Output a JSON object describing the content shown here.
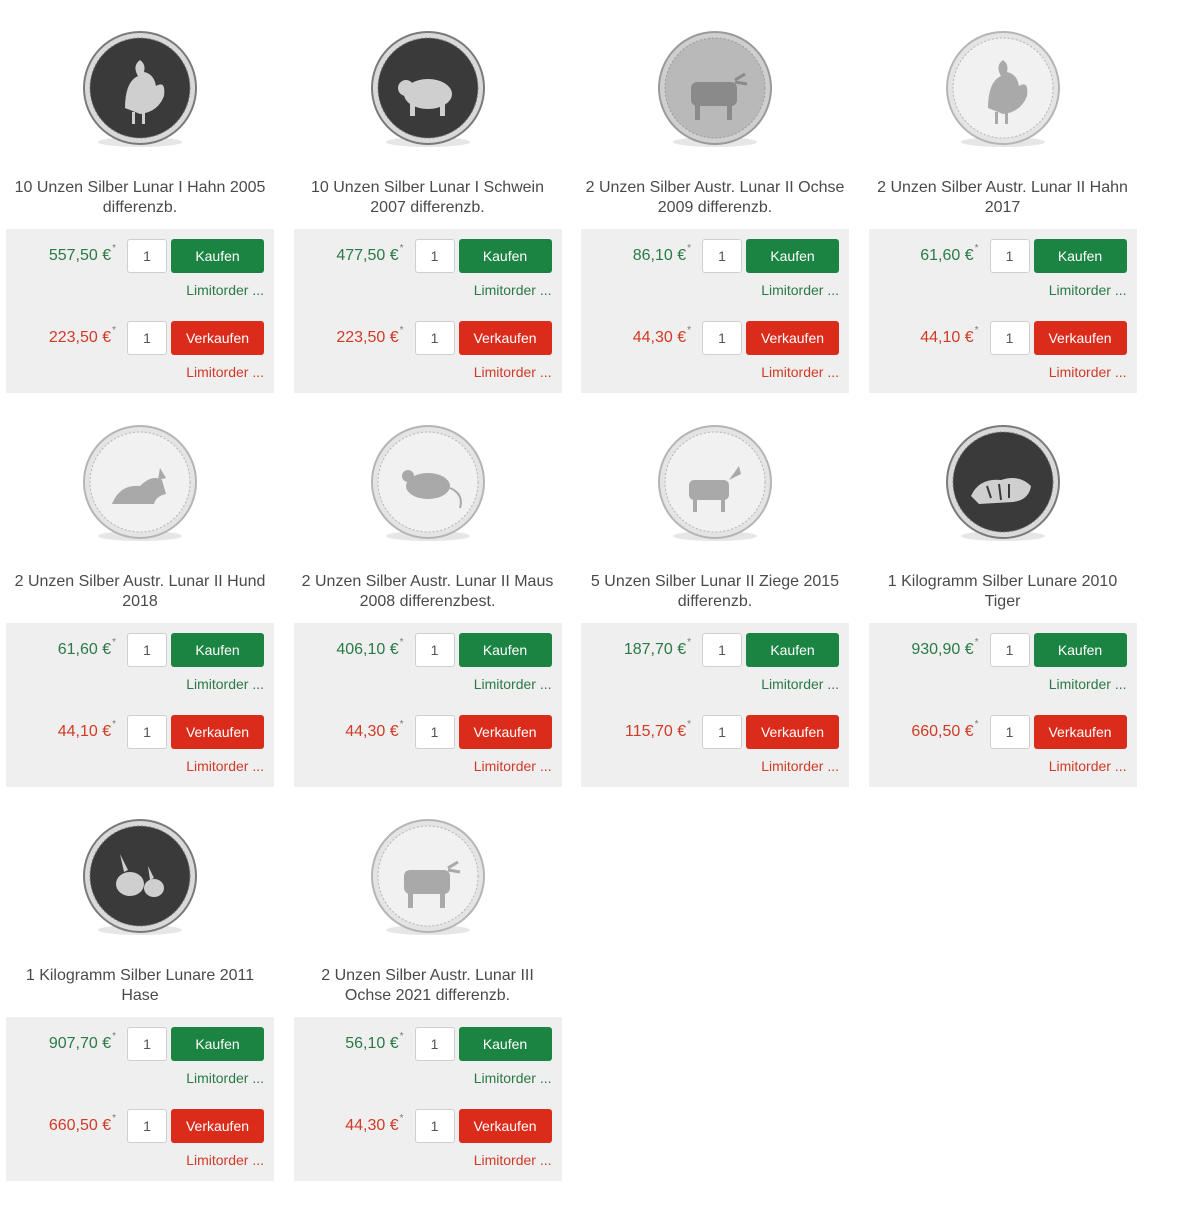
{
  "labels": {
    "buy_button": "Kaufen",
    "sell_button": "Verkaufen",
    "limit_order": "Limitorder ...",
    "price_marker": "*",
    "default_quantity": "1"
  },
  "colors": {
    "buy_green": "#1b8442",
    "sell_red": "#da2b1b",
    "panel_bg": "#efefef"
  },
  "products": [
    {
      "title": "10 Unzen Silber Lunar I Hahn 2005 differenzb.",
      "buy_price": "557,50 €",
      "sell_price": "223,50 €",
      "coin": {
        "icon": "rooster-coin-icon",
        "finish": "dark"
      }
    },
    {
      "title": "10 Unzen Silber Lunar I Schwein 2007 differenzb.",
      "buy_price": "477,50 €",
      "sell_price": "223,50 €",
      "coin": {
        "icon": "pig-coin-icon",
        "finish": "dark"
      }
    },
    {
      "title": "2 Unzen Silber Austr. Lunar II Ochse 2009 differenzb.",
      "buy_price": "86,10 €",
      "sell_price": "44,30 €",
      "coin": {
        "icon": "ox-coin-icon",
        "finish": "matte"
      }
    },
    {
      "title": "2 Unzen Silber Austr. Lunar II Hahn 2017",
      "buy_price": "61,60 €",
      "sell_price": "44,10 €",
      "coin": {
        "icon": "rooster-coin-icon",
        "finish": "bright"
      }
    },
    {
      "title": "2 Unzen Silber Austr. Lunar II Hund 2018",
      "buy_price": "61,60 €",
      "sell_price": "44,10 €",
      "coin": {
        "icon": "dog-coin-icon",
        "finish": "bright"
      }
    },
    {
      "title": "2 Unzen Silber Austr. Lunar II Maus 2008 differenzbest.",
      "buy_price": "406,10 €",
      "sell_price": "44,30 €",
      "coin": {
        "icon": "mouse-coin-icon",
        "finish": "bright"
      }
    },
    {
      "title": "5 Unzen Silber Lunar II Ziege 2015 differenzb.",
      "buy_price": "187,70 €",
      "sell_price": "115,70 €",
      "coin": {
        "icon": "goat-coin-icon",
        "finish": "bright"
      }
    },
    {
      "title": "1 Kilogramm Silber Lunare 2010 Tiger",
      "buy_price": "930,90 €",
      "sell_price": "660,50 €",
      "coin": {
        "icon": "tiger-coin-icon",
        "finish": "dark"
      }
    },
    {
      "title": "1 Kilogramm Silber Lunare 2011 Hase",
      "buy_price": "907,70 €",
      "sell_price": "660,50 €",
      "coin": {
        "icon": "rabbit-coin-icon",
        "finish": "dark"
      }
    },
    {
      "title": "2 Unzen Silber Austr. Lunar III Ochse 2021 differenzb.",
      "buy_price": "56,10 €",
      "sell_price": "44,30 €",
      "coin": {
        "icon": "ox-coin-icon",
        "finish": "bright"
      }
    }
  ]
}
